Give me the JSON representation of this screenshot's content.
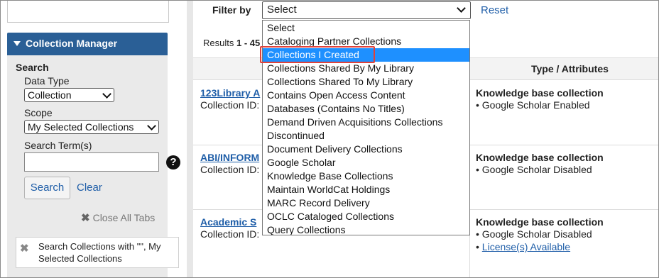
{
  "sidebar": {
    "panel_title": "Collection Manager",
    "search_heading": "Search",
    "data_type_label": "Data Type",
    "data_type_value": "Collection",
    "scope_label": "Scope",
    "scope_value": "My Selected Collections",
    "search_term_label": "Search Term(s)",
    "search_term_value": "",
    "help_icon": "?",
    "search_button": "Search",
    "clear_link": "Clear",
    "close_all_tabs_icon": "✖",
    "close_all_tabs": "Close All Tabs",
    "filter_tab_close_icon": "✖",
    "filter_tab_text": "Search Collections with \"\", My Selected Collections"
  },
  "main": {
    "filter_label": "Filter by",
    "filter_value": "Select",
    "reset_link": "Reset",
    "results_prefix": "Results",
    "results_range": "1 - 45",
    "type_header": "Type / Attributes",
    "rows": [
      {
        "name": "123Library A",
        "collection_id_label": "Collection ID:",
        "kb": "Knowledge base collection",
        "attrs": [
          "• Google Scholar Enabled"
        ],
        "license": ""
      },
      {
        "name": "ABI/INFORM",
        "collection_id_label": "Collection ID:",
        "kb": "Knowledge base collection",
        "attrs": [
          "• Google Scholar Disabled"
        ],
        "license": ""
      },
      {
        "name": "Academic S",
        "collection_id_label": "Collection ID:",
        "kb": "Knowledge base collection",
        "attrs": [
          "• Google Scholar Disabled"
        ],
        "license_bullet": "•",
        "license": "License(s) Available"
      }
    ]
  },
  "dropdown": {
    "highlighted_index": 2,
    "highlight_color": "#1e90ff",
    "callout_color": "#e0413a",
    "options": [
      "Select",
      "Cataloging Partner Collections",
      "Collections I Created",
      "Collections Shared By My Library",
      "Collections Shared To My Library",
      "Contains Open Access Content",
      "Databases (Contains No Titles)",
      "Demand Driven Acquisitions Collections",
      "Discontinued",
      "Document Delivery Collections",
      "Google Scholar",
      "Knowledge Base Collections",
      "Maintain WorldCat Holdings",
      "MARC Record Delivery",
      "OCLC Cataloged Collections",
      "Query Collections"
    ]
  },
  "colors": {
    "panel_header": "#2a5f96",
    "link": "#1f5ea8"
  }
}
